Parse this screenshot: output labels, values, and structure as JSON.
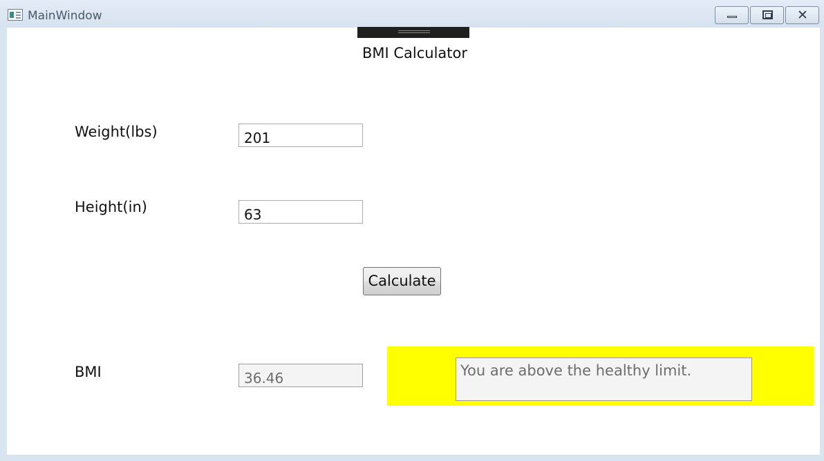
{
  "window": {
    "title": "MainWindow",
    "controls": {
      "minimize_icon": "minimize-icon",
      "maximize_icon": "maximize-icon",
      "close_icon": "close-icon"
    }
  },
  "heading": "BMI Calculator",
  "weight": {
    "label": "Weight(lbs)",
    "value": "201"
  },
  "height": {
    "label": "Height(in)",
    "value": "63"
  },
  "calculate_button": "Calculate",
  "bmi": {
    "label": "BMI",
    "value": "36.46"
  },
  "status": {
    "message": "You are above the healthy limit.",
    "highlight_color": "#ffff00"
  }
}
